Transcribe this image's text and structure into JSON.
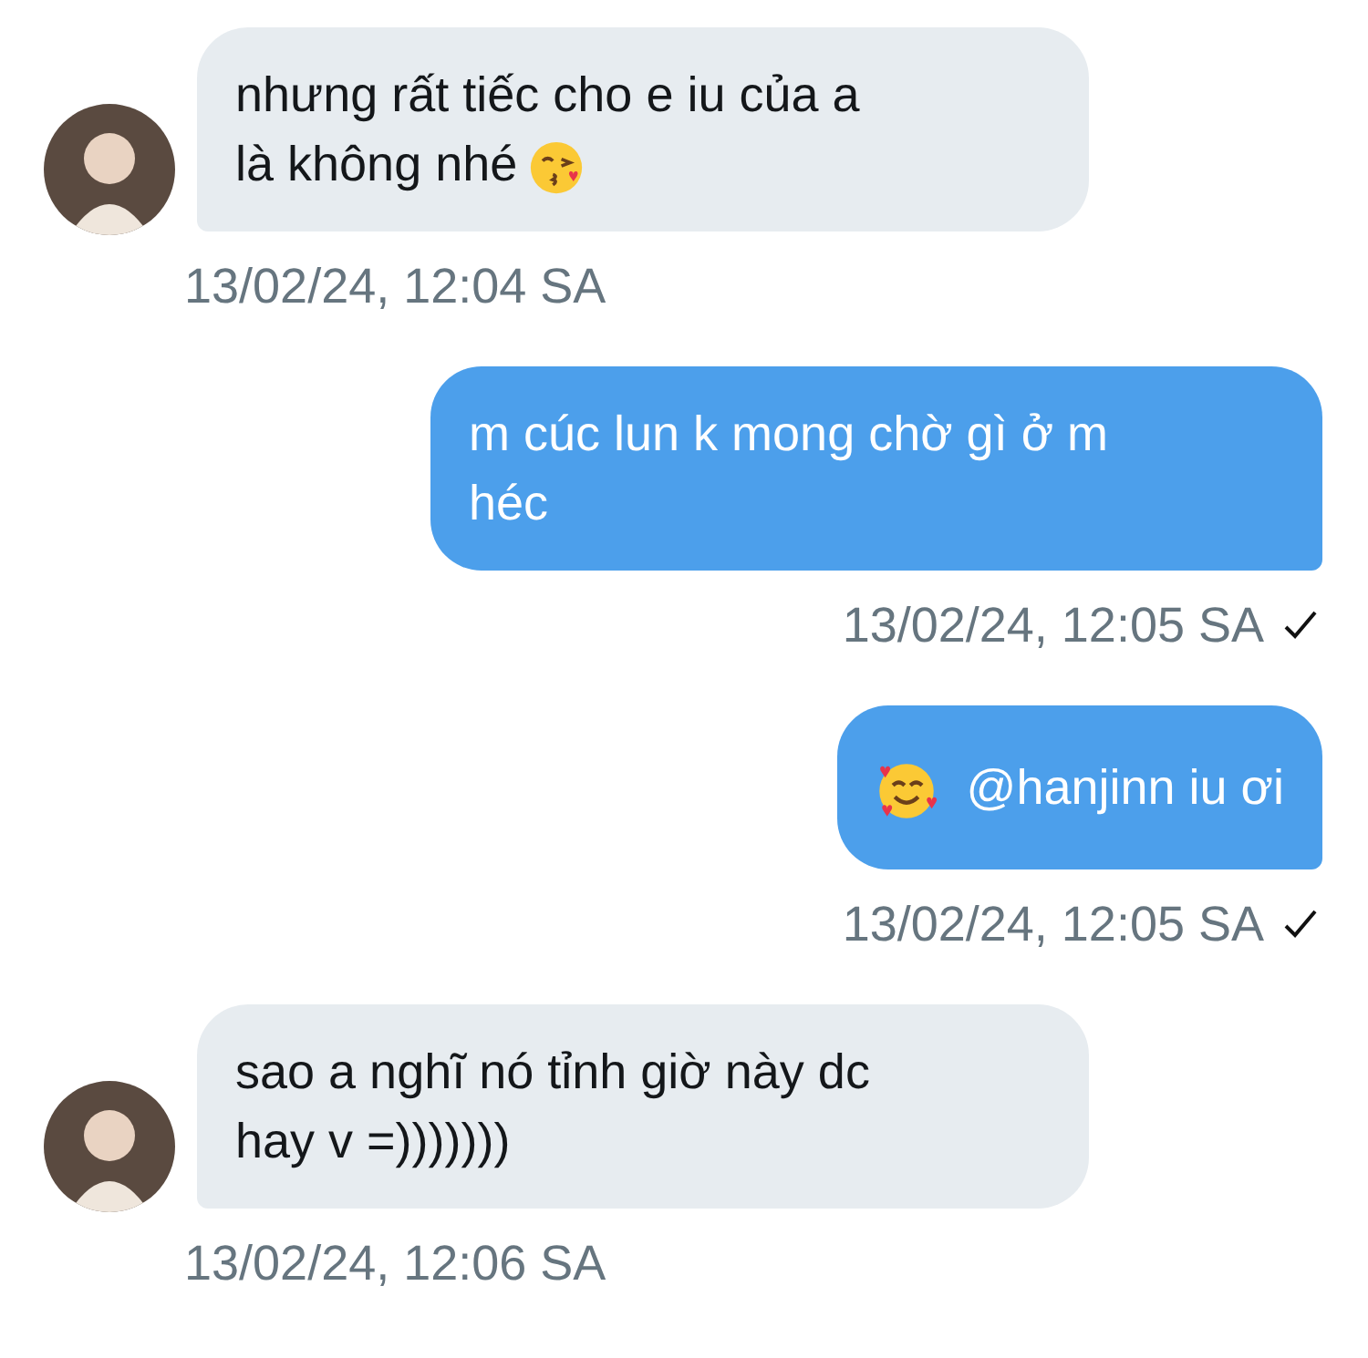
{
  "messages": [
    {
      "kind": "incoming",
      "parts": [
        {
          "kind": "text",
          "text": "nhưng rất tiếc cho e iu của a\nlà không nhé"
        },
        {
          "kind": "kiss"
        }
      ],
      "time": "13/02/24, 12:04 SA"
    },
    {
      "kind": "outgoing",
      "parts": [
        {
          "kind": "text",
          "text": "m cúc lun k mong chờ gì ở m\nhéc"
        }
      ],
      "time": "13/02/24, 12:05 SA",
      "read": true
    },
    {
      "kind": "outgoing",
      "parts": [
        {
          "kind": "hearts"
        },
        {
          "kind": "text",
          "text": "@hanjinn iu ơi"
        }
      ],
      "time": "13/02/24, 12:05 SA",
      "read": true
    },
    {
      "kind": "incoming",
      "parts": [
        {
          "kind": "text",
          "text": "sao a nghĩ nó tỉnh giờ này dc\nhay v =)))))))"
        }
      ],
      "time": "13/02/24, 12:06 SA"
    }
  ]
}
